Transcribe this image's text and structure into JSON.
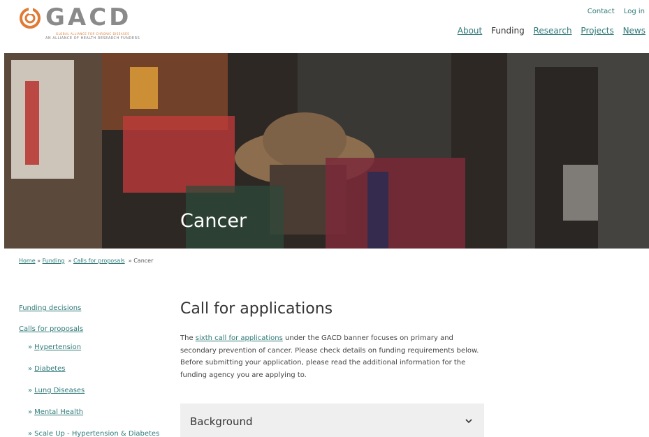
{
  "header": {
    "logo": {
      "word": "GACD",
      "tagline_1": "GLOBAL ALLIANCE FOR CHRONIC DISEASES",
      "tagline_2": "AN ALLIANCE OF HEALTH RESEARCH FUNDERS"
    },
    "util_nav": {
      "contact": "Contact",
      "login": "Log in"
    },
    "main_nav": {
      "about": "About",
      "funding": "Funding",
      "research": "Research",
      "projects": "Projects",
      "news": "News"
    }
  },
  "hero": {
    "title": "Cancer"
  },
  "breadcrumb": {
    "home": "Home",
    "sep": "»",
    "funding": "Funding",
    "calls": "Calls for proposals",
    "current": "Cancer"
  },
  "sidebar": {
    "funding_decisions": "Funding decisions",
    "calls_for_proposals": "Calls for proposals",
    "raquo": "»",
    "subitems": [
      "Hypertension",
      "Diabetes",
      "Lung Diseases",
      "Mental Health",
      "Scale Up - Hypertension & Diabetes"
    ]
  },
  "content": {
    "title": "Call for applications",
    "intro_prefix": "The ",
    "intro_link": "sixth call for applications",
    "intro_suffix": " under the GACD banner focuses on primary and secondary prevention of cancer. Please check details on funding requirements below. Before submitting your application, please read the additional information for the funding agency you are applying to.",
    "accordion_title": "Background"
  },
  "colors": {
    "link": "#2f7a78",
    "logo_orange": "#e07a35",
    "logo_grey": "#8a8a8a",
    "accordion_bg": "#efefef"
  },
  "icons": {
    "logo_mark": "gacd-swirl-icon",
    "accordion_chevron": "chevron-down-icon"
  }
}
